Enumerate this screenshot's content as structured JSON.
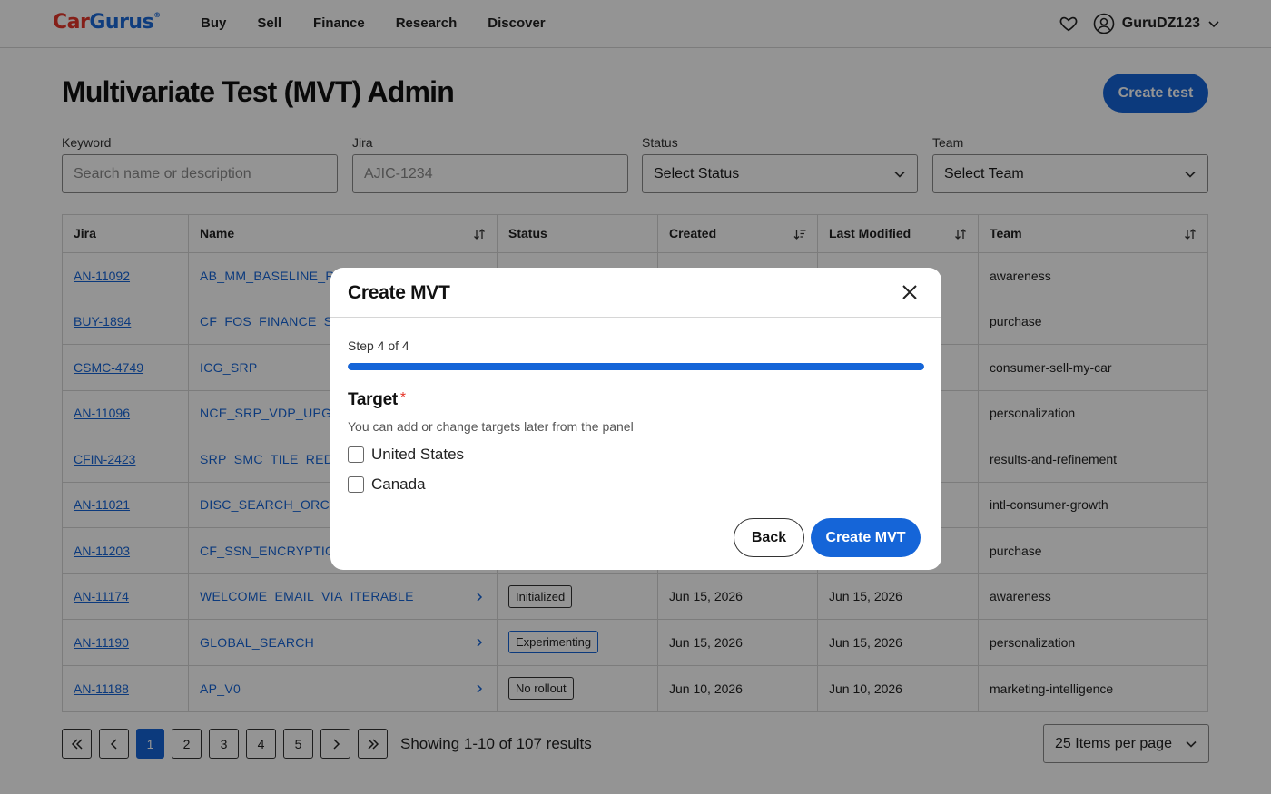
{
  "header": {
    "logo_car": "Car",
    "logo_gurus": "Gurus",
    "logo_reg": "®",
    "nav": [
      "Buy",
      "Sell",
      "Finance",
      "Research",
      "Discover"
    ],
    "username": "GuruDZ123"
  },
  "page": {
    "title": "Multivariate Test (MVT) Admin",
    "create_button": "Create test"
  },
  "filters": {
    "keyword": {
      "label": "Keyword",
      "placeholder": "Search name or description"
    },
    "jira": {
      "label": "Jira",
      "placeholder": "AJIC-1234"
    },
    "status": {
      "label": "Status",
      "value": "Select Status"
    },
    "team": {
      "label": "Team",
      "value": "Select Team"
    }
  },
  "table": {
    "headers": [
      "Jira",
      "Name",
      "Status",
      "Created",
      "Last Modified",
      "Team"
    ],
    "rows": [
      {
        "jira": "AN-11092",
        "name": "AB_MM_BASELINE_RESU",
        "status": "",
        "created": "",
        "modified": "",
        "team": "awareness"
      },
      {
        "jira": "BUY-1894",
        "name": "CF_FOS_FINANCE_STR",
        "status": "",
        "created": "",
        "modified": "",
        "team": "purchase"
      },
      {
        "jira": "CSMC-4749",
        "name": "ICG_SRP",
        "status": "",
        "created": "",
        "modified": "",
        "team": "consumer-sell-my-car"
      },
      {
        "jira": "AN-11096",
        "name": "NCE_SRP_VDP_UPGRA",
        "status": "",
        "created": "",
        "modified": "",
        "team": "personalization"
      },
      {
        "jira": "CFIN-2423",
        "name": "SRP_SMC_TILE_REDESI",
        "status": "",
        "created": "",
        "modified": "",
        "team": "results-and-refinement"
      },
      {
        "jira": "AN-11021",
        "name": "DISC_SEARCH_ORCH",
        "status": "",
        "created": "",
        "modified": "",
        "team": "intl-consumer-growth"
      },
      {
        "jira": "AN-11203",
        "name": "CF_SSN_ENCRYPTION",
        "status": "",
        "created": "",
        "modified": "",
        "team": "purchase"
      },
      {
        "jira": "AN-11174",
        "name": "WELCOME_EMAIL_VIA_ITERABLE",
        "status": "Initialized",
        "created": "Jun 15, 2026",
        "modified": "Jun 15, 2026",
        "team": "awareness"
      },
      {
        "jira": "AN-11190",
        "name": "GLOBAL_SEARCH",
        "status": "Experimenting",
        "created": "Jun 15, 2026",
        "modified": "Jun 15, 2026",
        "team": "personalization"
      },
      {
        "jira": "AN-11188",
        "name": "AP_V0",
        "status": "No rollout",
        "created": "Jun 10, 2026",
        "modified": "Jun 10, 2026",
        "team": "marketing-intelligence"
      }
    ]
  },
  "pagination": {
    "pages": [
      "1",
      "2",
      "3",
      "4",
      "5"
    ],
    "current": "1",
    "showing": "Showing 1-10 of 107 results",
    "per_page": "25 Items per page"
  },
  "modal": {
    "title": "Create MVT",
    "step": "Step 4 of 4",
    "progress": 1.0,
    "target_title": "Target",
    "required_mark": "*",
    "help": "You can add or change targets later from the panel",
    "options": [
      {
        "label": "United States",
        "checked": false
      },
      {
        "label": "Canada",
        "checked": false
      }
    ],
    "back": "Back",
    "submit": "Create MVT"
  },
  "colors": {
    "primary": "#1565d8",
    "logo_red": "#e6362a",
    "overlay": "rgba(0,0,0,0.42)"
  }
}
